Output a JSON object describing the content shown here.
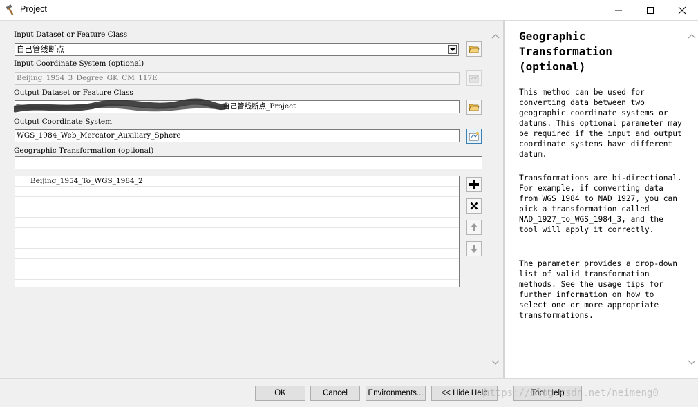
{
  "window": {
    "title": "Project",
    "minimize_icon": "minimize-icon",
    "maximize_icon": "maximize-icon",
    "close_icon": "close-icon"
  },
  "form": {
    "input_dataset": {
      "label": "Input Dataset or Feature Class",
      "value": "自己管线断点"
    },
    "input_cs": {
      "label": "Input Coordinate System (optional)",
      "value": "Beijing_1954_3_Degree_GK_CM_117E"
    },
    "output_dataset": {
      "label": "Output Dataset or Feature Class",
      "value_visible_suffix": "自己管线断点_Project"
    },
    "output_cs": {
      "label": "Output Coordinate System",
      "value": "WGS_1984_Web_Mercator_Auxiliary_Sphere"
    },
    "geo_transform": {
      "label": "Geographic Transformation (optional)",
      "value": ""
    },
    "transform_list": [
      "Beijing_1954_To_WGS_1984_2"
    ]
  },
  "help": {
    "title": "Geographic Transformation (optional)",
    "paragraphs": [
      "This method can be used for converting data between two geographic coordinate systems or datums. This optional parameter may be required if the input and output coordinate systems have different datum.",
      "Transformations are bi-directional. For example, if converting data from WGS 1984 to NAD 1927, you can pick a transformation called NAD_1927_to_WGS_1984_3, and the tool will apply it correctly.",
      "The parameter provides a drop-down list of valid transformation methods. See the usage tips for further information on how to select one or more appropriate transformations."
    ]
  },
  "buttons": {
    "ok": "OK",
    "cancel": "Cancel",
    "environments": "Environments...",
    "hide_help": "<< Hide Help",
    "tool_help": "Tool Help"
  },
  "watermark": "https://blog.csdn.net/neimeng0",
  "colors": {
    "accent": "#3c7fb1",
    "folder": "#e8b84a"
  }
}
